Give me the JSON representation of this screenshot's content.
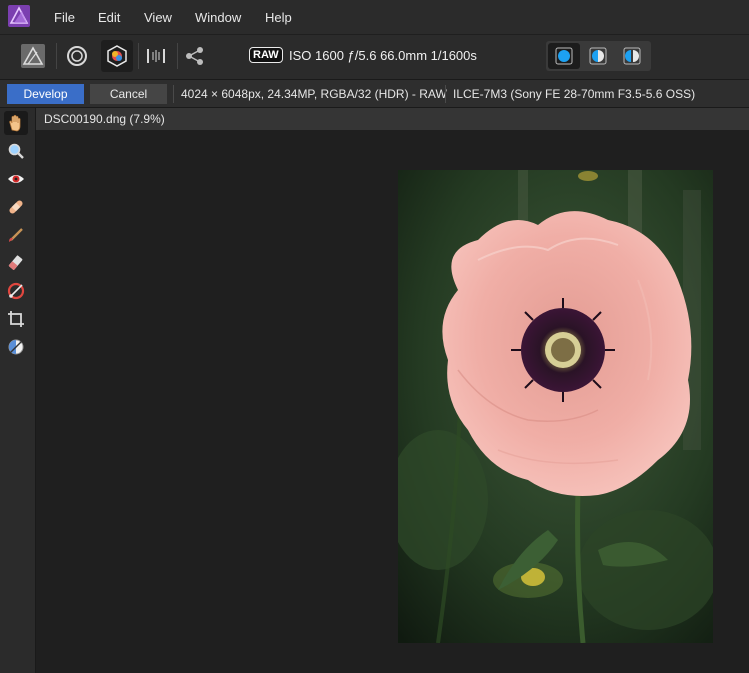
{
  "app": {
    "logo_icon": "affinity-photo-logo-icon",
    "accent": "#3a6ec8"
  },
  "menu": [
    "File",
    "Edit",
    "View",
    "Window",
    "Help"
  ],
  "toolbar": {
    "raw_badge": "RAW",
    "exif": "ISO 1600 ƒ/5.6 66.0mm 1/1600s",
    "buttons": [
      "persona-photo-icon",
      "persona-liquify-icon",
      "persona-develop-icon",
      "persona-tonemap-icon",
      "persona-export-icon"
    ],
    "view_modes": [
      "single-view-icon",
      "split-view-icon",
      "mirror-view-icon"
    ]
  },
  "context": {
    "develop_label": "Develop",
    "cancel_label": "Cancel",
    "image_info": "4024 × 6048px, 24.34MP, RGBA/32 (HDR) - RAW",
    "camera_info": "ILCE-7M3 (Sony FE 28-70mm F3.5-5.6 OSS)"
  },
  "tools": [
    "view-tool-icon",
    "zoom-tool-icon",
    "red-eye-tool-icon",
    "blemish-removal-tool-icon",
    "overlay-paint-tool-icon",
    "overlay-erase-tool-icon",
    "overlay-gradient-tool-icon",
    "crop-tool-icon",
    "white-balance-tool-icon"
  ],
  "document": {
    "tab_title": "DSC00190.dng (7.9%)"
  }
}
